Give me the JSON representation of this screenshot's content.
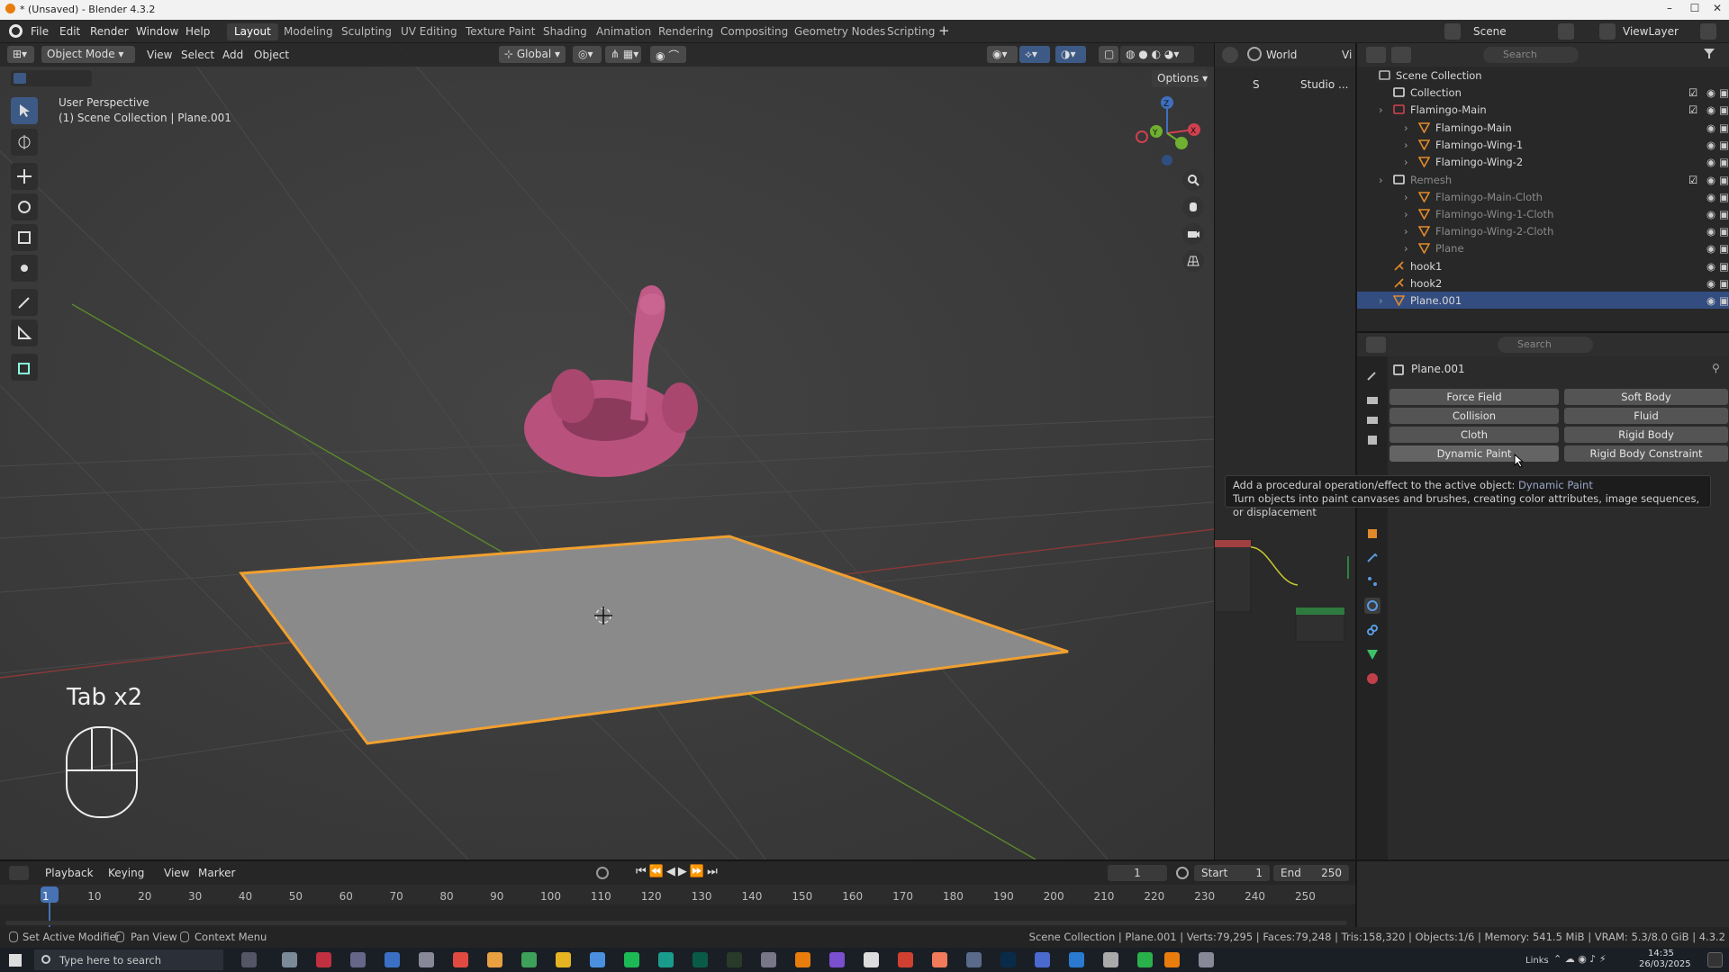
{
  "window": {
    "title": "* (Unsaved) - Blender 4.3.2"
  },
  "menu": {
    "file": "File",
    "edit": "Edit",
    "render": "Render",
    "window": "Window",
    "help": "Help"
  },
  "workspaces": [
    "Layout",
    "Modeling",
    "Sculpting",
    "UV Editing",
    "Texture Paint",
    "Shading",
    "Animation",
    "Rendering",
    "Compositing",
    "Geometry Nodes",
    "Scripting"
  ],
  "active_workspace": "Layout",
  "scene": {
    "label": "Scene",
    "viewlayer": "ViewLayer"
  },
  "viewport": {
    "mode": "Object Mode",
    "menus": {
      "view": "View",
      "select": "Select",
      "add": "Add",
      "object": "Object"
    },
    "orientation": "Global",
    "options": "Options",
    "info_line1": "User Perspective",
    "info_line2": "(1) Scene Collection | Plane.001",
    "overlay_key": "Tab x2",
    "gizmo": {
      "x": "X",
      "y": "Y",
      "z": "Z"
    }
  },
  "node_header": {
    "world": "World",
    "vi": "Vi",
    "studio": "Studio ...",
    "s": "S"
  },
  "outliner": {
    "search_placeholder": "Search",
    "items": [
      {
        "label": "Scene Collection"
      },
      {
        "label": "Collection"
      },
      {
        "label": "Flamingo-Main"
      },
      {
        "label": "Flamingo-Main"
      },
      {
        "label": "Flamingo-Wing-1"
      },
      {
        "label": "Flamingo-Wing-2"
      },
      {
        "label": "Remesh"
      },
      {
        "label": "Flamingo-Main-Cloth"
      },
      {
        "label": "Flamingo-Wing-1-Cloth"
      },
      {
        "label": "Flamingo-Wing-2-Cloth"
      },
      {
        "label": "Plane"
      },
      {
        "label": "hook1"
      },
      {
        "label": "hook2"
      },
      {
        "label": "Plane.001"
      }
    ]
  },
  "properties": {
    "search_placeholder": "Search",
    "object_name": "Plane.001",
    "physics": {
      "force_field": "Force Field",
      "soft_body": "Soft Body",
      "collision": "Collision",
      "fluid": "Fluid",
      "cloth": "Cloth",
      "rigid_body": "Rigid Body",
      "dynamic_paint": "Dynamic Paint",
      "rigid_body_constraint": "Rigid Body Constraint"
    }
  },
  "tooltip": {
    "prefix": "Add a procedural operation/effect to the active object: ",
    "name": "Dynamic Paint",
    "desc": "Turn objects into paint canvases and brushes, creating color attributes, image sequences, or displacement"
  },
  "timeline": {
    "menus": {
      "playback": "Playback",
      "keying": "Keying",
      "view": "View",
      "marker": "Marker"
    },
    "current_frame": "1",
    "start_label": "Start",
    "start": "1",
    "end_label": "End",
    "end": "250",
    "ticks": [
      "1",
      "10",
      "20",
      "30",
      "40",
      "50",
      "60",
      "70",
      "80",
      "90",
      "100",
      "110",
      "120",
      "130",
      "140",
      "150",
      "160",
      "170",
      "180",
      "190",
      "200",
      "210",
      "220",
      "230",
      "240",
      "250"
    ]
  },
  "statusbar": {
    "set_active_modifier": "Set Active Modifier",
    "pan_view": "Pan View",
    "context_menu": "Context Menu",
    "stats": "Scene Collection | Plane.001 | Verts:79,295 | Faces:79,248 | Tris:158,320 | Objects:1/6 | Memory: 541.5 MiB | VRAM: 5.3/8.0 GiB | 4.3.2"
  },
  "taskbar": {
    "search_placeholder": "Type here to search",
    "links": "Links",
    "time": "14:35",
    "date": "26/03/2025"
  },
  "colors": {
    "selection": "#334d80",
    "plane_outline": "#f0a030",
    "flamingo": "#c05a86",
    "accent_blue": "#4772b3"
  }
}
